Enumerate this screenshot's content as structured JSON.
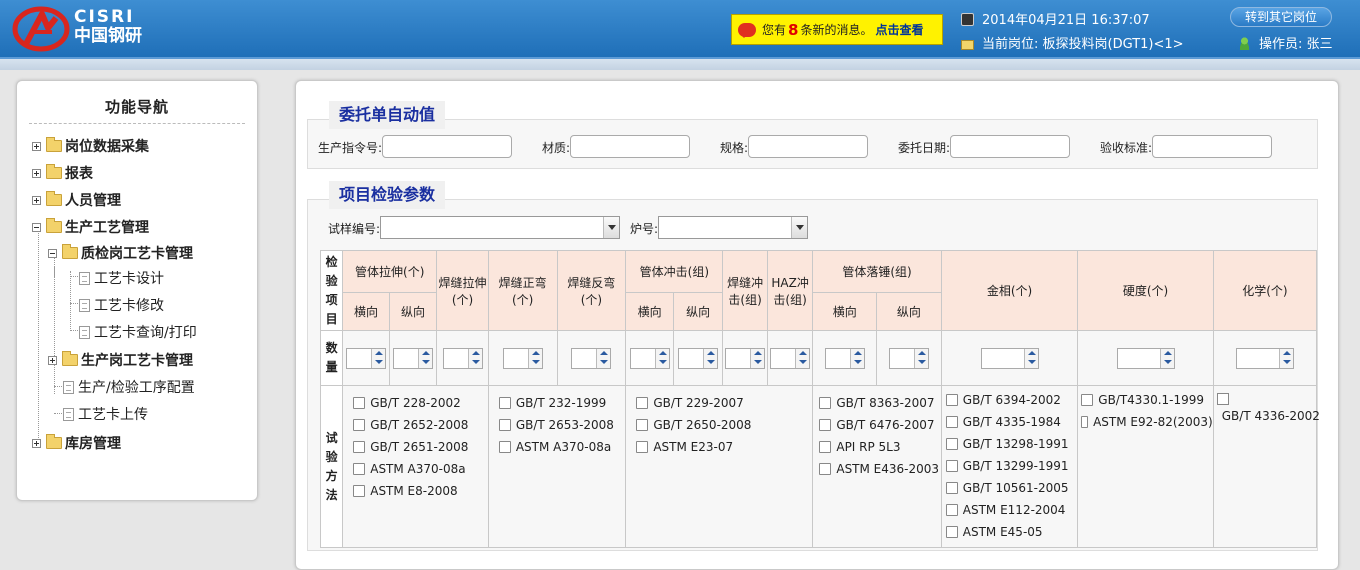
{
  "header": {
    "logo_en": "CISRI",
    "logo_cn": "中国钢研",
    "message": {
      "prefix": "您有",
      "count": "8",
      "suffix": "条新的消息。",
      "link": "点击查看"
    },
    "datetime": "2014年04月21日 16:37:07",
    "current_post": "当前岗位: 板探投料岗(DGT1)<1>",
    "switch_button": "转到其它岗位",
    "operator": "操作员: 张三"
  },
  "sidebar": {
    "title": "功能导航",
    "items": [
      {
        "label": "岗位数据采集"
      },
      {
        "label": "报表"
      },
      {
        "label": "人员管理"
      },
      {
        "label": "生产工艺管理"
      },
      {
        "label": "质检岗工艺卡管理"
      },
      {
        "label": "工艺卡设计"
      },
      {
        "label": "工艺卡修改"
      },
      {
        "label": "工艺卡查询/打印"
      },
      {
        "label": "生产岗工艺卡管理"
      },
      {
        "label": "生产/检验工序配置"
      },
      {
        "label": "工艺卡上传"
      },
      {
        "label": "库房管理"
      }
    ]
  },
  "order": {
    "title": "委托单自动值",
    "fields": [
      {
        "label": "生产指令号:",
        "value": ""
      },
      {
        "label": "材质:",
        "value": ""
      },
      {
        "label": "规格:",
        "value": ""
      },
      {
        "label": "委托日期:",
        "value": ""
      },
      {
        "label": "验收标准:",
        "value": ""
      }
    ]
  },
  "params": {
    "title": "项目检验参数",
    "sample_label": "试样编号:",
    "sample_value": "",
    "furnace_label": "炉号:",
    "furnace_value": "",
    "row_labels": {
      "item": "检验项目",
      "qty": "数量",
      "method": "试验方法"
    },
    "headers": {
      "tube_tensile": "管体拉伸(个)",
      "weld_tensile": "焊缝拉伸(个)",
      "weld_face_bend": "焊缝正弯(个)",
      "weld_back_bend": "焊缝反弯(个)",
      "tube_impact": "管体冲击(组)",
      "weld_impact": "焊缝冲击(组)",
      "haz_impact": "HAZ冲击(组)",
      "tube_dwtt": "管体落锤(组)",
      "metallography": "金相(个)",
      "hardness": "硬度(个)",
      "chemistry": "化学(个)",
      "transverse": "横向",
      "longitudinal": "纵向"
    },
    "methods": {
      "tensile": [
        "GB/T 228-2002",
        "GB/T 2652-2008",
        "GB/T 2651-2008",
        "ASTM A370-08a",
        "ASTM E8-2008"
      ],
      "bend": [
        "GB/T 232-1999",
        "GB/T 2653-2008",
        "ASTM A370-08a"
      ],
      "impact": [
        "GB/T 229-2007",
        "GB/T 2650-2008",
        "ASTM E23-07"
      ],
      "dwtt": [
        "GB/T 8363-2007",
        "GB/T 6476-2007",
        "API RP 5L3",
        "ASTM E436-2003"
      ],
      "metallography": [
        "GB/T 6394-2002",
        "GB/T 4335-1984",
        "GB/T 13298-1991",
        "GB/T 13299-1991",
        "GB/T 10561-2005",
        "ASTM E112-2004",
        "ASTM E45-05"
      ],
      "hardness": [
        "GB/T4330.1-1999",
        "ASTM E92-82(2003)"
      ],
      "chemistry": [
        "GB/T 4336-2002"
      ]
    }
  }
}
